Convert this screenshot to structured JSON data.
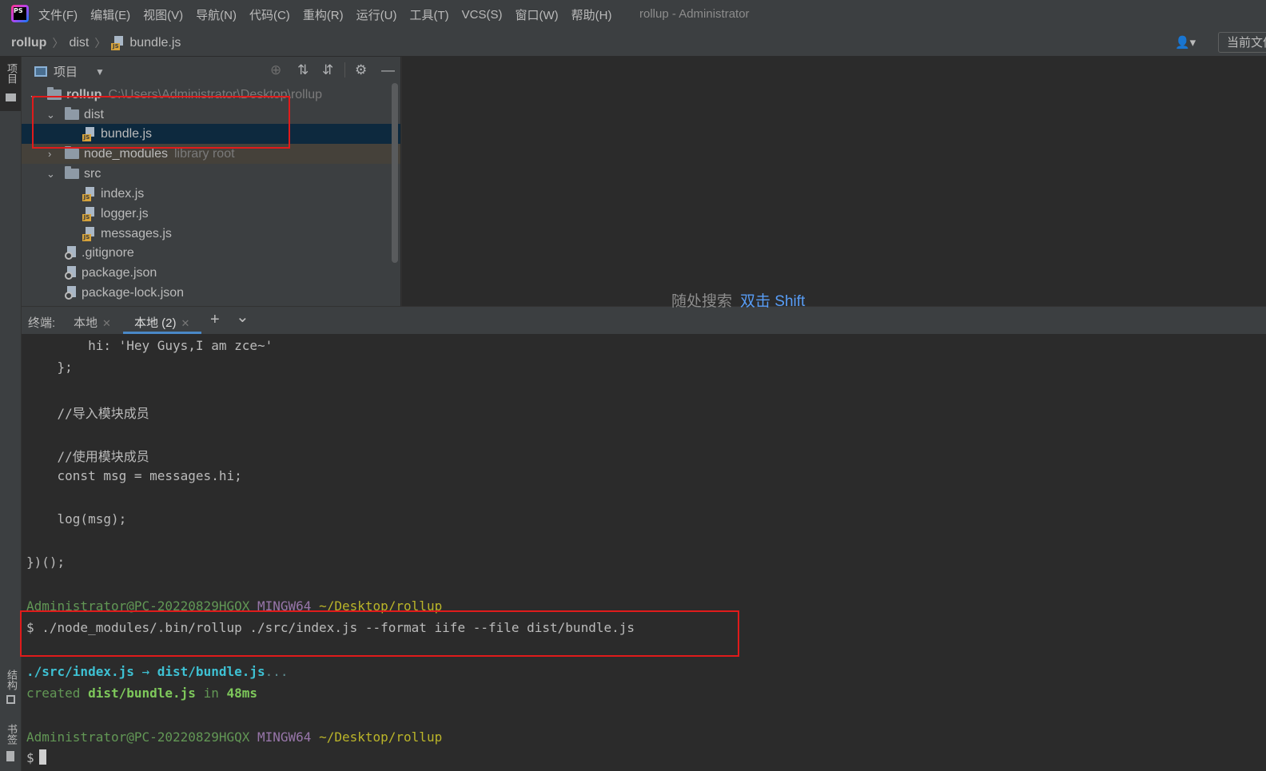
{
  "menubar": {
    "logo_text": "PS",
    "items": [
      "文件(F)",
      "编辑(E)",
      "视图(V)",
      "导航(N)",
      "代码(C)",
      "重构(R)",
      "运行(U)",
      "工具(T)",
      "VCS(S)",
      "窗口(W)",
      "帮助(H)"
    ],
    "window_title": "rollup - Administrator"
  },
  "breadcrumb": {
    "project": "rollup",
    "folder": "dist",
    "file": "bundle.js",
    "file_badge": "JS",
    "user_icon_glyph": "👤▾",
    "current_file_button": "当前文件"
  },
  "left_strip": {
    "project_tab": "项目",
    "structure_tab": "结构",
    "bookmarks_tab": "书签"
  },
  "project_panel": {
    "title": "项目",
    "dropdown_glyph": "▼",
    "tools": {
      "locate": "⊕",
      "expand": "⇅",
      "collapse": "⇵",
      "settings": "⚙",
      "hide": "—"
    },
    "tree": {
      "root_name": "rollup",
      "root_path": "C:\\Users\\Administrator\\Desktop\\rollup",
      "dist": "dist",
      "bundle": "bundle.js",
      "node_modules": "node_modules",
      "node_modules_note": "library root",
      "src": "src",
      "index": "index.js",
      "logger": "logger.js",
      "messages": "messages.js",
      "gitignore": ".gitignore",
      "package": "package.json",
      "package_lock": "package-lock.json"
    }
  },
  "editor": {
    "hint_text": "随处搜索",
    "hint_key": "双击 Shift"
  },
  "terminal_tabs": {
    "label": "终端:",
    "tab1": "本地",
    "tab2": "本地 (2)",
    "add": "+",
    "more": "⌄"
  },
  "terminal": {
    "l1": "        hi: 'Hey Guys,I am zce~'",
    "l2": "    };",
    "l3": "    //导入模块成员",
    "l4": "    //使用模块成员",
    "l5": "    const msg = messages.hi;",
    "l6": "    log(msg);",
    "l7": "})();",
    "prompt1_user": "Administrator@PC-20220829HGQX",
    "prompt1_env": "MINGW64",
    "prompt1_path": "~/Desktop/rollup",
    "command": "$ ./node_modules/.bin/rollup ./src/index.js --format iife --file dist/bundle.js",
    "out_src": "./src/index.js",
    "out_arrow": " → ",
    "out_dest": "dist/bundle.js",
    "out_dots": "...",
    "created_word": "created",
    "created_file": "dist/bundle.js",
    "created_in": "in",
    "created_time": "48ms",
    "prompt2_user": "Administrator@PC-20220829HGQX",
    "prompt2_env": "MINGW64",
    "prompt2_path": "~/Desktop/rollup",
    "final_prompt": "$"
  }
}
